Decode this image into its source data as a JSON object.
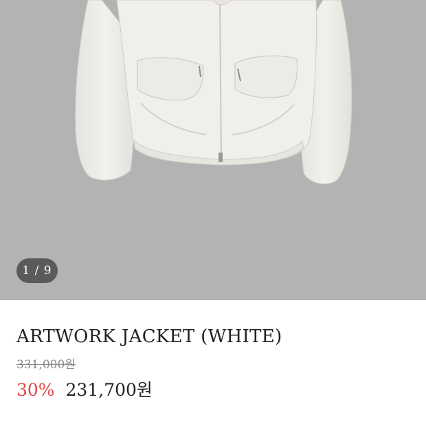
{
  "gallery": {
    "image": "white-jacket-photo",
    "counter": "1 / 9",
    "colors": {
      "background": "#b3b3b3",
      "counter_bg": "#5a5a5a"
    }
  },
  "product": {
    "title": "ARTWORK JACKET (WHITE)",
    "original_price": "331,000원",
    "discount_rate": "30%",
    "sale_price": "231,700원"
  },
  "colors": {
    "discount": "#e04848",
    "text": "#222222",
    "muted": "#8a8a8a"
  }
}
